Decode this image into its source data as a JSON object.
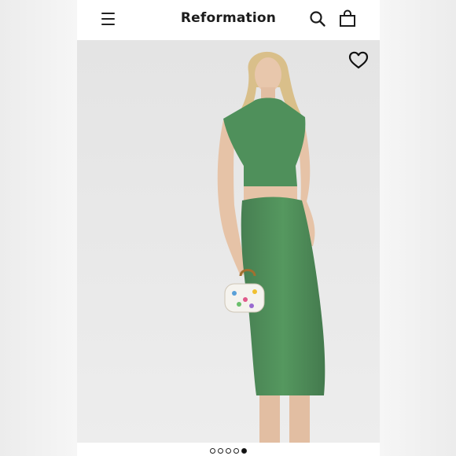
{
  "header": {
    "brand": "Reformation",
    "icons": [
      "menu-icon",
      "search-icon",
      "shopping-bag-icon"
    ]
  },
  "product_image": {
    "favorite_icon": "heart-icon",
    "outfit_color": "#4e8f5a",
    "background_color": "#e9e9e9"
  },
  "carousel": {
    "total": 5,
    "active_index": 4
  }
}
